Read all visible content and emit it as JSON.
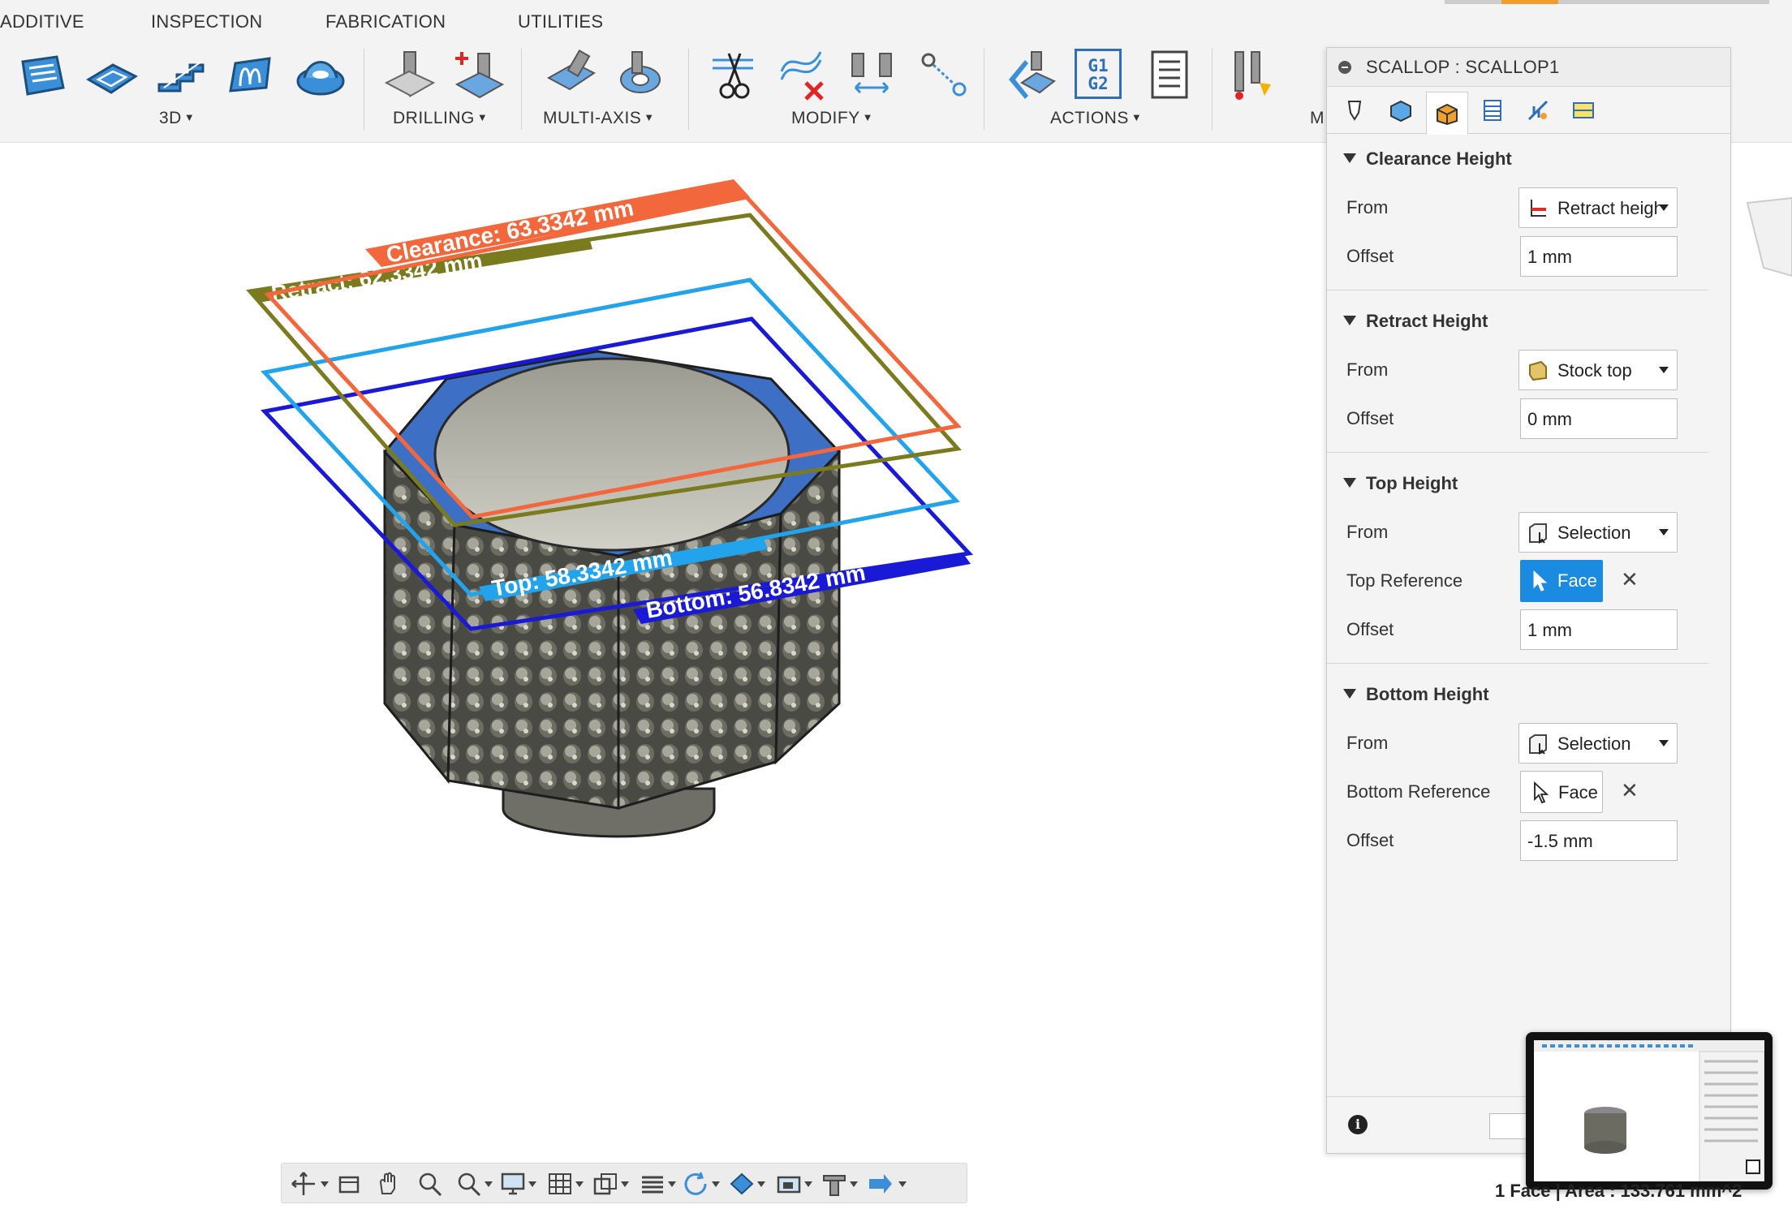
{
  "menu": {
    "tabs": [
      "ADDITIVE",
      "INSPECTION",
      "FABRICATION",
      "UTILITIES"
    ]
  },
  "toolbar": {
    "groups": [
      {
        "label": "3D",
        "has_menu": true
      },
      {
        "label": "DRILLING",
        "has_menu": true
      },
      {
        "label": "MULTI-AXIS",
        "has_menu": true
      },
      {
        "label": "MODIFY",
        "has_menu": true
      },
      {
        "label": "ACTIONS",
        "has_menu": true
      },
      {
        "label": "M",
        "has_menu": false
      }
    ],
    "post_icon_text": "G1\nG2",
    "post_icon_line1": "G1",
    "post_icon_line2": "G2",
    "icons": [
      "2d-adaptive-icon",
      "pocket-icon",
      "steep-shallow-icon",
      "contour-icon",
      "scallop-icon",
      "drill-icon",
      "hole-recognition-icon",
      "swarf-icon",
      "multiaxis-contour-icon",
      "trim-icon",
      "delete-toolpath-icon",
      "compare-tools-icon",
      "pattern-icon",
      "simulate-icon",
      "post-process-icon",
      "setup-sheet-icon",
      "tool-library-icon"
    ]
  },
  "viewport": {
    "labels": {
      "clearance": "Clearance: 63.3342 mm",
      "retract": "Retract: 62.3342 mm",
      "top": "Top: 58.3342 mm",
      "bottom": "Bottom: 56.8342 mm"
    },
    "colors": {
      "clearance": "#f2673c",
      "retract": "#7a7a1f",
      "top": "#22a3ec",
      "bottom": "#1a1ad6",
      "top_face": "#3d6fc4"
    }
  },
  "panel": {
    "title": "SCALLOP : SCALLOP1",
    "tabs": [
      "tool-tab",
      "geometry-tab",
      "heights-tab",
      "passes-tab",
      "linking-tab",
      "post-tab"
    ],
    "active_tab": 2,
    "sections": {
      "clearance": {
        "title": "Clearance Height",
        "from_label": "From",
        "from_value": "Retract height",
        "offset_label": "Offset",
        "offset_value": "1 mm"
      },
      "retract": {
        "title": "Retract Height",
        "from_label": "From",
        "from_value": "Stock top",
        "offset_label": "Offset",
        "offset_value": "0 mm"
      },
      "top": {
        "title": "Top Height",
        "from_label": "From",
        "from_value": "Selection",
        "reference_label": "Top Reference",
        "reference_value": "Face",
        "offset_label": "Offset",
        "offset_value": "1 mm"
      },
      "bottom": {
        "title": "Bottom Height",
        "from_label": "From",
        "from_value": "Selection",
        "reference_label": "Bottom Reference",
        "reference_value": "Face",
        "offset_label": "Offset",
        "offset_value": "-1.5 mm"
      }
    },
    "clear_symbol": "✕",
    "info_symbol": "i"
  },
  "status": {
    "text": "1 Face | Area : 133.761 mm^2"
  },
  "navbar": {
    "icons": [
      "orbit-icon",
      "look-at-icon",
      "pan-icon",
      "zoom-icon",
      "zoom-window-icon",
      "display-settings-icon",
      "grid-icon",
      "viewports-icon",
      "effects-icon",
      "orbit-mode-icon",
      "environment-icon",
      "camera-icon",
      "tool-display-icon",
      "simulation-icon"
    ]
  }
}
